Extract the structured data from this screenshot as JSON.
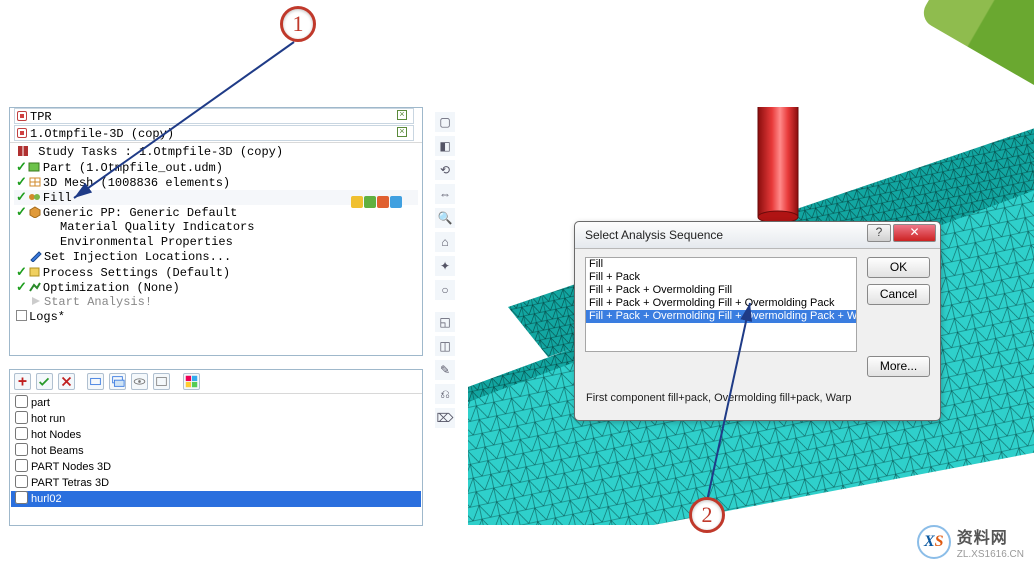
{
  "tabs": {
    "a": {
      "label": "TPR"
    },
    "b": {
      "label": "1.Otmpfile-3D (copy)"
    }
  },
  "study": {
    "title": "Study Tasks : 1.Otmpfile-3D (copy)",
    "part": "Part (1.Otmpfile_out.udm)",
    "mesh": "3D Mesh (1008836 elements)",
    "fill": "Fill",
    "generic": "Generic PP: Generic Default",
    "mqi": "Material Quality Indicators",
    "envp": "Environmental Properties",
    "setinj": "Set Injection Locations...",
    "procset": "Process Settings (Default)",
    "opt": "Optimization (None)",
    "start": "Start Analysis!",
    "logs": "Logs*"
  },
  "layers": {
    "items": [
      "part",
      "hot run",
      "hot Nodes",
      "hot Beams",
      "PART Nodes 3D",
      "PART Tetras 3D",
      "hurl02"
    ]
  },
  "dialog": {
    "title": "Select Analysis Sequence",
    "options": [
      "Fill",
      "Fill + Pack",
      "Fill + Pack + Overmolding Fill",
      "Fill + Pack + Overmolding Fill + Overmolding Pack",
      "Fill + Pack + Overmolding Fill + Overmolding Pack + Warp"
    ],
    "selectedIndex": 4,
    "description": "First component fill+pack, Overmolding fill+pack, Warp",
    "buttons": {
      "ok": "OK",
      "cancel": "Cancel",
      "more": "More..."
    }
  },
  "annotations": {
    "one": "1",
    "two": "2"
  },
  "watermark": {
    "brand": "资料网",
    "url": "ZL.XS1616.CN",
    "x": "X",
    "s": "S"
  },
  "colors": {
    "mesh_fill": "#27c4c0",
    "mesh_stroke": "#0a5856",
    "sprue": "#d81f1f",
    "highlight": "#2a6fde"
  },
  "chart_data": null
}
